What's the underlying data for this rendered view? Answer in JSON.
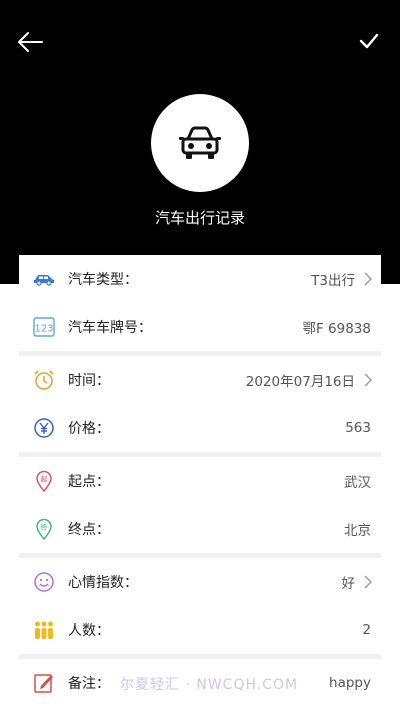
{
  "header": {
    "title": "汽车出行记录"
  },
  "groups": [
    {
      "rows": [
        {
          "label": "汽车类型：",
          "value": "T3出行",
          "icon": "car-icon",
          "arrow": true
        },
        {
          "label": "汽车车牌号：",
          "value": "鄂F 69838",
          "icon": "plate-icon",
          "arrow": false
        }
      ]
    },
    {
      "rows": [
        {
          "label": "时间：",
          "value": "2020年07月16日",
          "icon": "alarm-clock-icon",
          "arrow": true
        },
        {
          "label": "价格：",
          "value": "563",
          "icon": "yen-icon",
          "arrow": false
        }
      ]
    },
    {
      "rows": [
        {
          "label": "起点：",
          "value": "武汉",
          "icon": "start-pin-icon",
          "arrow": false
        },
        {
          "label": "终点：",
          "value": "北京",
          "icon": "end-pin-icon",
          "arrow": false
        }
      ]
    },
    {
      "rows": [
        {
          "label": "心情指数：",
          "value": "好",
          "icon": "smile-icon",
          "arrow": true
        },
        {
          "label": "人数：",
          "value": "2",
          "icon": "people-icon",
          "arrow": false
        }
      ]
    },
    {
      "rows": [
        {
          "label": "备注：",
          "value": "happy",
          "icon": "note-icon",
          "arrow": false
        }
      ]
    }
  ],
  "start_pin_text": "起",
  "end_pin_text": "终",
  "watermark": "尔夏轻汇 · NWCQH.COM",
  "colors": {
    "header_bg": "#000000",
    "car_blue": "#3a78d8",
    "plate_blue": "#5aa7e0",
    "clock_orange": "#f0a030",
    "yen_blue": "#3a5ec8",
    "start_red": "#e0506a",
    "end_green": "#3dbf6a",
    "smile_purple": "#b070d8",
    "people_yellow": "#f2b820",
    "note_red": "#e04848"
  }
}
